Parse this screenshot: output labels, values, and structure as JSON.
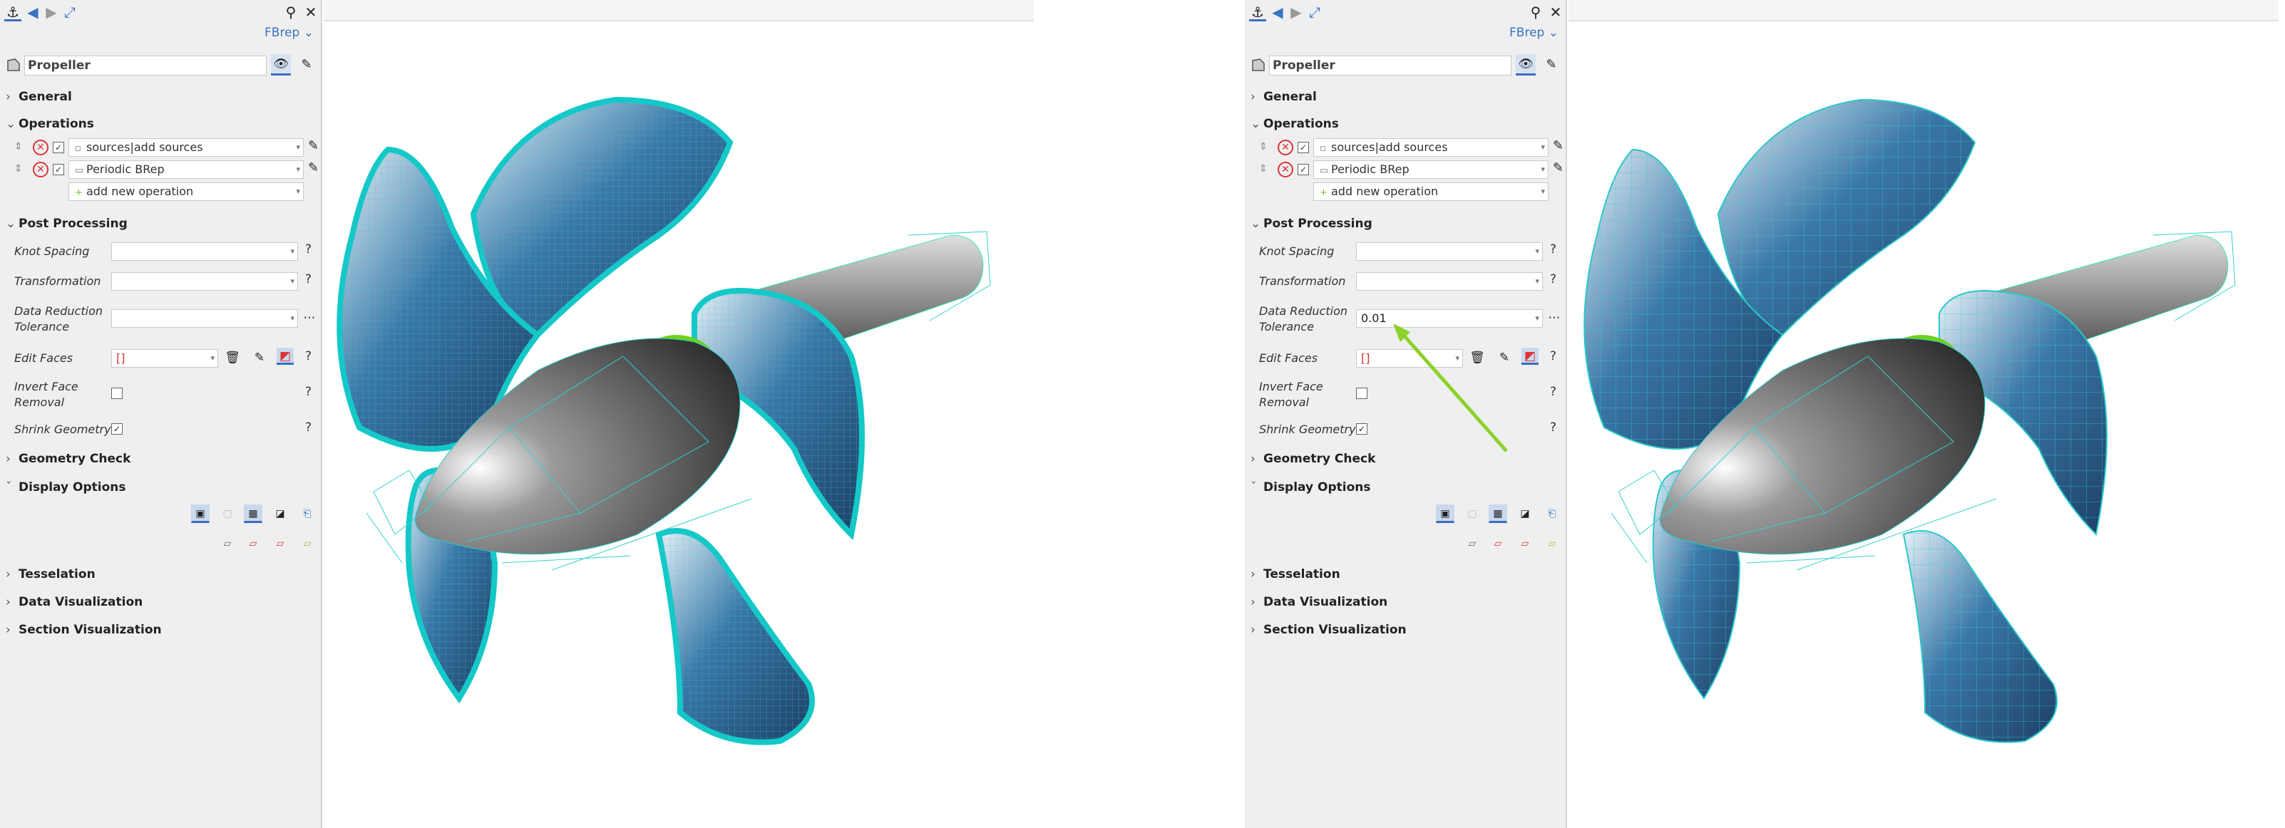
{
  "panel": {
    "mode_label": "FBrep",
    "object_name": "Propeller",
    "sections": {
      "general": "General",
      "operations": "Operations",
      "post_processing": "Post Processing",
      "geometry_check": "Geometry Check",
      "display_options": "Display Options",
      "tesselation": "Tesselation",
      "data_visualization": "Data Visualization",
      "section_visualization": "Section Visualization"
    },
    "operations": [
      {
        "label": "sources|add sources"
      },
      {
        "label": "Periodic BRep"
      }
    ],
    "add_operation_label": "add new operation",
    "props": {
      "knot_spacing": "Knot Spacing",
      "transformation": "Transformation",
      "data_reduction_1": "Data Reduction",
      "data_reduction_2": "Tolerance",
      "edit_faces": "Edit Faces",
      "invert_face_1": "Invert Face",
      "invert_face_2": "Removal",
      "shrink_geometry": "Shrink Geometry"
    },
    "help_glyph": "?"
  },
  "left": {
    "data_reduction_value": "",
    "edit_faces_value": "[]"
  },
  "right": {
    "data_reduction_value": "0.01",
    "edit_faces_value": "[]"
  },
  "colors": {
    "accent": "#3a74c2",
    "arrow": "#8cd12a",
    "mesh": "#19c8c8"
  }
}
